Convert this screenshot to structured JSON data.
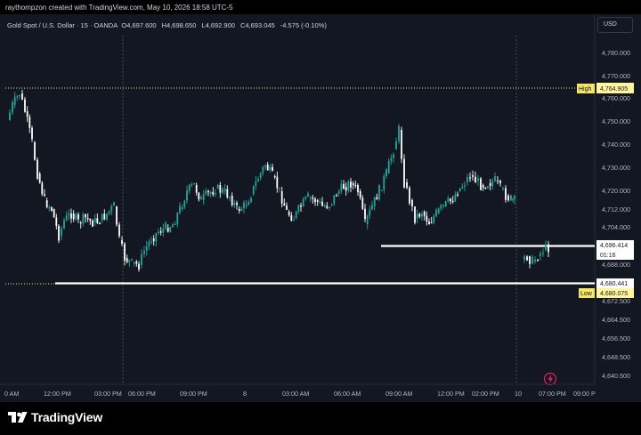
{
  "attribution": "raythompzon created with TradingView.com, May 10, 2026 18:58 UTC-5",
  "symbol": {
    "name": "Gold Spot / U.S. Dollar · 15 · OANDA",
    "open_label": "O",
    "open": "4,697.600",
    "high_label": "H",
    "high": "4,698.650",
    "low_label": "L",
    "low": "4,692.900",
    "close_label": "C",
    "close": "4,693.045",
    "change": "-4.575 (-0.10%)"
  },
  "currency": "USD",
  "price_axis": {
    "ticks": [
      "4,780.000",
      "4,770.000",
      "4,760.000",
      "4,750.000",
      "4,740.000",
      "4,730.000",
      "4,720.000",
      "4,712.000",
      "4,704.000",
      "4,688.000",
      "4,672.500",
      "4,664.500",
      "4,656.500",
      "4,648.500",
      "4,640.500"
    ],
    "high_tag": {
      "label": "High",
      "value": "4,764.905"
    },
    "current_tag": {
      "value": "4,696.414",
      "countdown": "01:16"
    },
    "line_tag": {
      "value": "4,680.441"
    },
    "low_tag": {
      "label": "Low",
      "value": "4,680.075"
    }
  },
  "time_axis": {
    "labels": [
      "0 AM",
      "12:00 PM",
      "03:00 PM",
      "06:00 PM",
      "09:00 PM",
      "8",
      "03:00 AM",
      "06:00 AM",
      "09:00 AM",
      "12:00 PM",
      "02:00 PM",
      "10",
      "07:00 PM",
      "09:00 P"
    ]
  },
  "brand": "TradingView",
  "colors": {
    "up": "#26a69a",
    "down": "#ffffff",
    "background": "#131722",
    "high_line": "#f0e68c"
  }
}
